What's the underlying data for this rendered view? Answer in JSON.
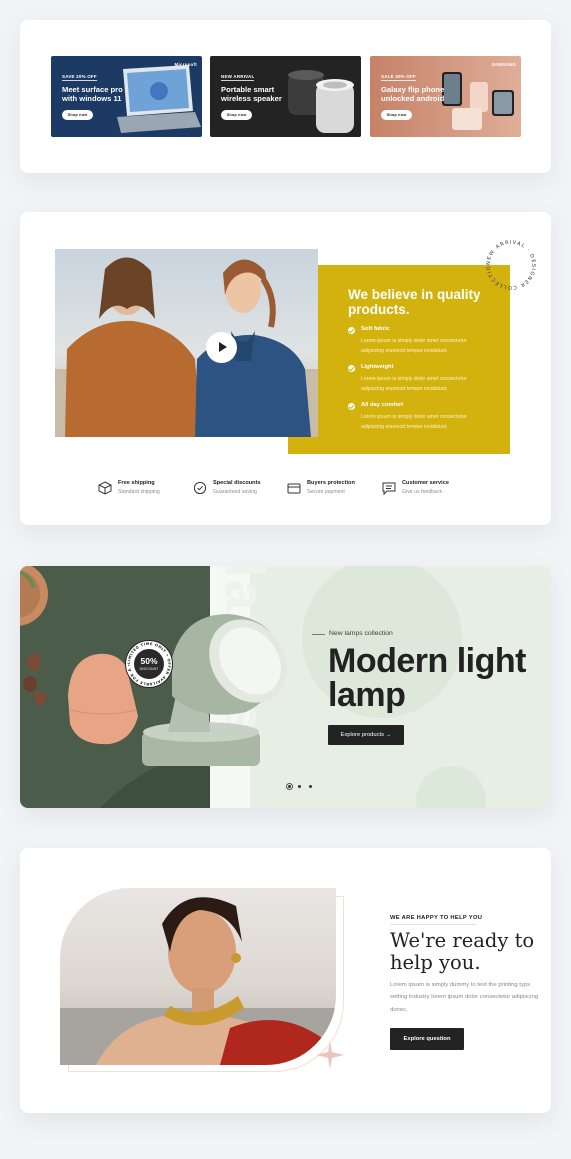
{
  "promos": [
    {
      "tag": "Save 20% off",
      "title": "Meet surface pro with windows 11",
      "button": "Shop now",
      "brand": "Microsoft",
      "bg": "#1c3a63"
    },
    {
      "tag": "New arrival",
      "title": "Portable smart wireless speaker",
      "button": "Shop now",
      "brand": "",
      "bg": "#232323"
    },
    {
      "tag": "Sale 30% off",
      "title": "Galaxy flip phone unlocked android",
      "button": "Shop now",
      "brand": "SAMSUNG",
      "bg": "#c88a73"
    }
  ],
  "about": {
    "title": "We believe in quality products.",
    "badge_text": "NEW ARRIVAL · DESIGNER COLLECTION",
    "features": [
      {
        "title": "Soft fabric",
        "desc": "Lorem ipsum is simply dolor amet consectetur adipiscing eiusmod tempor incididunt."
      },
      {
        "title": "Lightweight",
        "desc": "Lorem ipsum is simply dolor amet consectetur adipiscing eiusmod tempor incididunt."
      },
      {
        "title": "All day comfort",
        "desc": "Lorem ipsum is simply dolor amet consectetur adipiscing eiusmod tempor incididunt."
      }
    ],
    "services": [
      {
        "title": "Free shipping",
        "desc": "Standard shipping",
        "icon": "box-icon"
      },
      {
        "title": "Special discounts",
        "desc": "Guaranteed saving",
        "icon": "discount-badge-icon"
      },
      {
        "title": "Buyers protection",
        "desc": "Secure payment",
        "icon": "card-icon"
      },
      {
        "title": "Customer service",
        "desc": "Give us feedback",
        "icon": "chat-icon"
      }
    ]
  },
  "lamp": {
    "vertical_text": "lamps",
    "tagline": "New lamps collection",
    "heading": "Modern light lamp",
    "button": "Explore products",
    "badge_pct": "50%",
    "badge_label": "DISCOUNT",
    "badge_ring": "LIMITED TIME ONLY • OFFER AVAILABLE FOR A •",
    "slider_active": 1,
    "slider_count": 3
  },
  "help": {
    "eyebrow": "WE ARE HAPPY TO HELP YOU",
    "heading": "We're ready to help you.",
    "text": "Lorem ipsum is simply dummy to text the printing typs setting industry lorem ipsum dolor consectetur adipiscing donec.",
    "button": "Explore question"
  }
}
